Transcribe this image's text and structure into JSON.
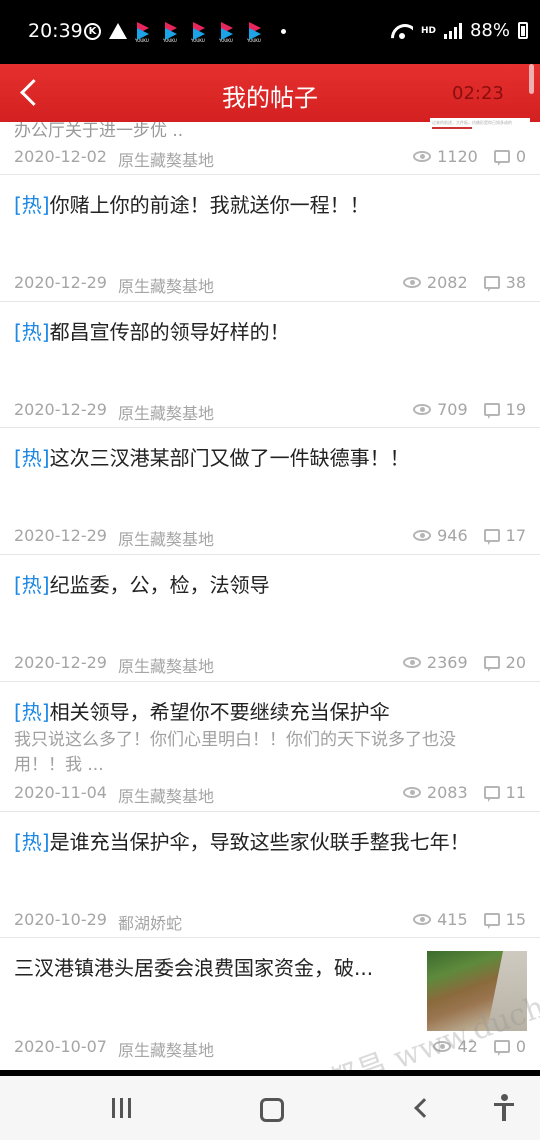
{
  "status_bar": {
    "time": "20:39",
    "k_icon_letter": "K",
    "app_icon_label": "YOUKU",
    "network": "HD",
    "battery": "88%"
  },
  "header": {
    "title": "我的帖子",
    "timer": "02:23",
    "overlay_text": "过来的前述，大件板，仿佛形是你已知多成的"
  },
  "partial_item": {
    "excerpt": "办公厅关于进一步优 ..",
    "date": "2020-12-02",
    "author": "原生藏獒基地",
    "views": "1120",
    "comments": "0"
  },
  "hot_tag": "[热]",
  "posts": [
    {
      "hot": true,
      "title": "你赌上你的前途！我就送你一程！！",
      "excerpt": "",
      "date": "2020-12-29",
      "author": "原生藏獒基地",
      "views": "2082",
      "comments": "38"
    },
    {
      "hot": true,
      "title": "都昌宣传部的领导好样的！",
      "excerpt": "",
      "date": "2020-12-29",
      "author": "原生藏獒基地",
      "views": "709",
      "comments": "19"
    },
    {
      "hot": true,
      "title": "这次三汊港某部门又做了一件缺德事！！",
      "excerpt": "",
      "date": "2020-12-29",
      "author": "原生藏獒基地",
      "views": "946",
      "comments": "17"
    },
    {
      "hot": true,
      "title": "纪监委，公，检，法领导",
      "excerpt": "",
      "date": "2020-12-29",
      "author": "原生藏獒基地",
      "views": "2369",
      "comments": "20"
    },
    {
      "hot": true,
      "title": "相关领导，希望你不要继续充当保护伞",
      "excerpt_line1": "我只说这么多了！你们心里明白！！你们的天下说多了也没",
      "excerpt_line2": "用！！我 ...",
      "date": "2020-11-04",
      "author": "原生藏獒基地",
      "views": "2083",
      "comments": "11"
    },
    {
      "hot": true,
      "title": "是谁充当保护伞，导致这些家伙联手整我七年！",
      "excerpt": "",
      "date": "2020-10-29",
      "author": "鄱湖娇蛇",
      "views": "415",
      "comments": "15"
    },
    {
      "hot": false,
      "title": "三汊港镇港头居委会浪费国家资金，破...",
      "excerpt": "",
      "date": "2020-10-07",
      "author": "原生藏獒基地",
      "views": "42",
      "comments": "0"
    }
  ],
  "watermark": "都昌 www.duchang"
}
